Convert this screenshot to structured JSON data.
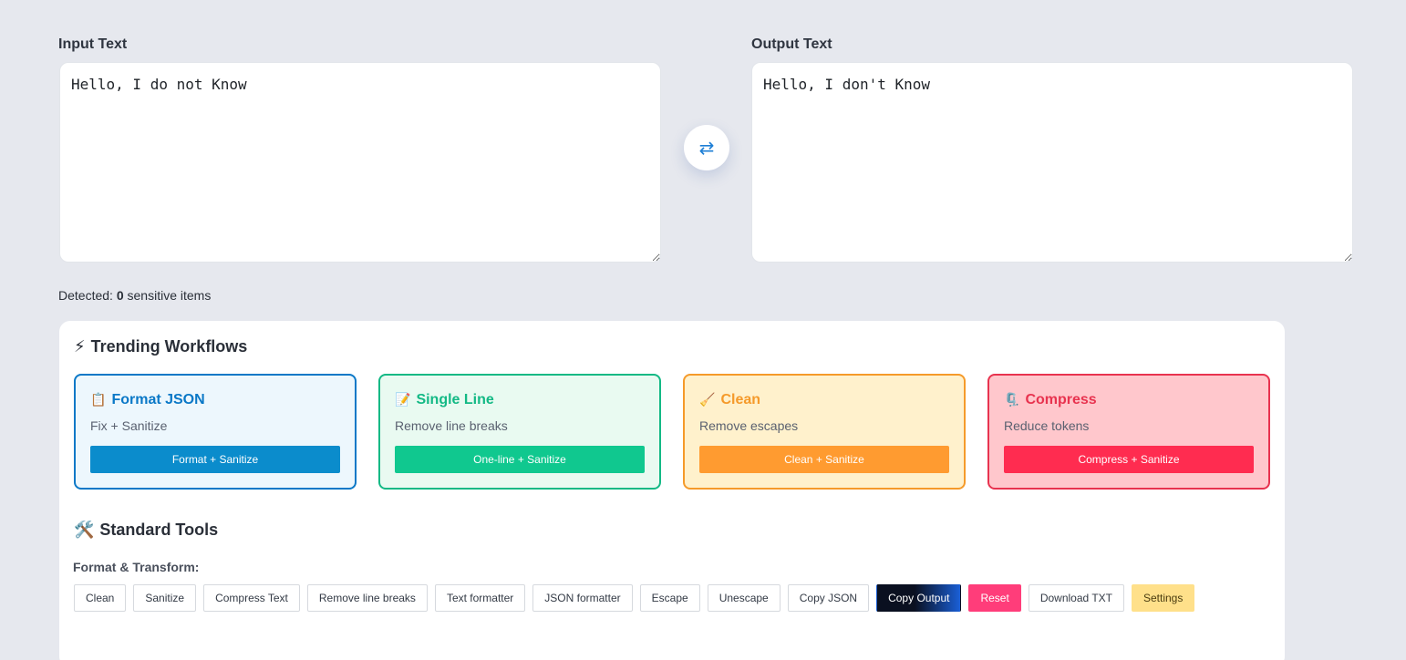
{
  "input": {
    "label": "Input Text",
    "value": "Hello, I do not Know"
  },
  "output": {
    "label": "Output Text",
    "value": "Hello, I don't Know"
  },
  "swap": {
    "icon": "swap-arrows-icon",
    "glyph": "⇄"
  },
  "detected": {
    "prefix": "Detected:",
    "count": "0",
    "suffix": "sensitive items"
  },
  "trending": {
    "icon": "⚡",
    "title": "Trending Workflows",
    "cards": [
      {
        "icon": "📋",
        "title": "Format JSON",
        "desc": "Fix + Sanitize",
        "button": "Format + Sanitize",
        "accent": "#0a78c7",
        "bg": "#edf7fd",
        "btn": "#0b8ccc"
      },
      {
        "icon": "📝",
        "title": "Single Line",
        "desc": "Remove line breaks",
        "button": "One-line + Sanitize",
        "accent": "#13b985",
        "bg": "#e9faf1",
        "btn": "#10c88f"
      },
      {
        "icon": "🧹",
        "title": "Clean",
        "desc": "Remove escapes",
        "button": "Clean + Sanitize",
        "accent": "#f59a2a",
        "bg": "#fff1cc",
        "btn": "#ff9b30"
      },
      {
        "icon": "🗜️",
        "title": "Compress",
        "desc": "Reduce tokens",
        "button": "Compress + Sanitize",
        "accent": "#e8334f",
        "bg": "#ffc7cc",
        "btn": "#ff2c50"
      }
    ]
  },
  "standard": {
    "icon": "🛠️",
    "title": "Standard Tools",
    "subhead": "Format & Transform:",
    "buttons": [
      "Clean",
      "Sanitize",
      "Compress Text",
      "Remove line breaks",
      "Text formatter",
      "JSON formatter",
      "Escape",
      "Unescape",
      "Copy JSON",
      "Copy Output",
      "Reset",
      "Download TXT",
      "Settings"
    ]
  }
}
